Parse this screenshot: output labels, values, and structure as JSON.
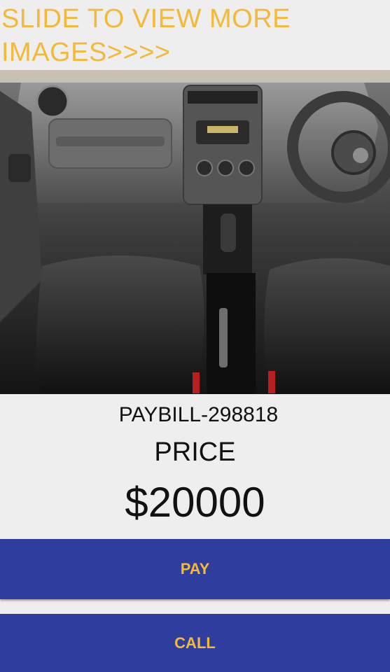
{
  "header": {
    "slide_hint_line1": "SLIDE TO VIEW MORE",
    "slide_hint_line2": "IMAGES>>>>"
  },
  "gallery": {
    "image_subject": "car interior dashboard and seats"
  },
  "listing": {
    "paybill": "PAYBILL-298818",
    "price_label": "PRICE",
    "price_value": "$20000"
  },
  "actions": {
    "pay_label": "PAY",
    "call_label": "CALL"
  },
  "colors": {
    "accent_text": "#f3b93b",
    "button_bg": "#2f3e9e",
    "page_bg": "#eeeeee"
  }
}
